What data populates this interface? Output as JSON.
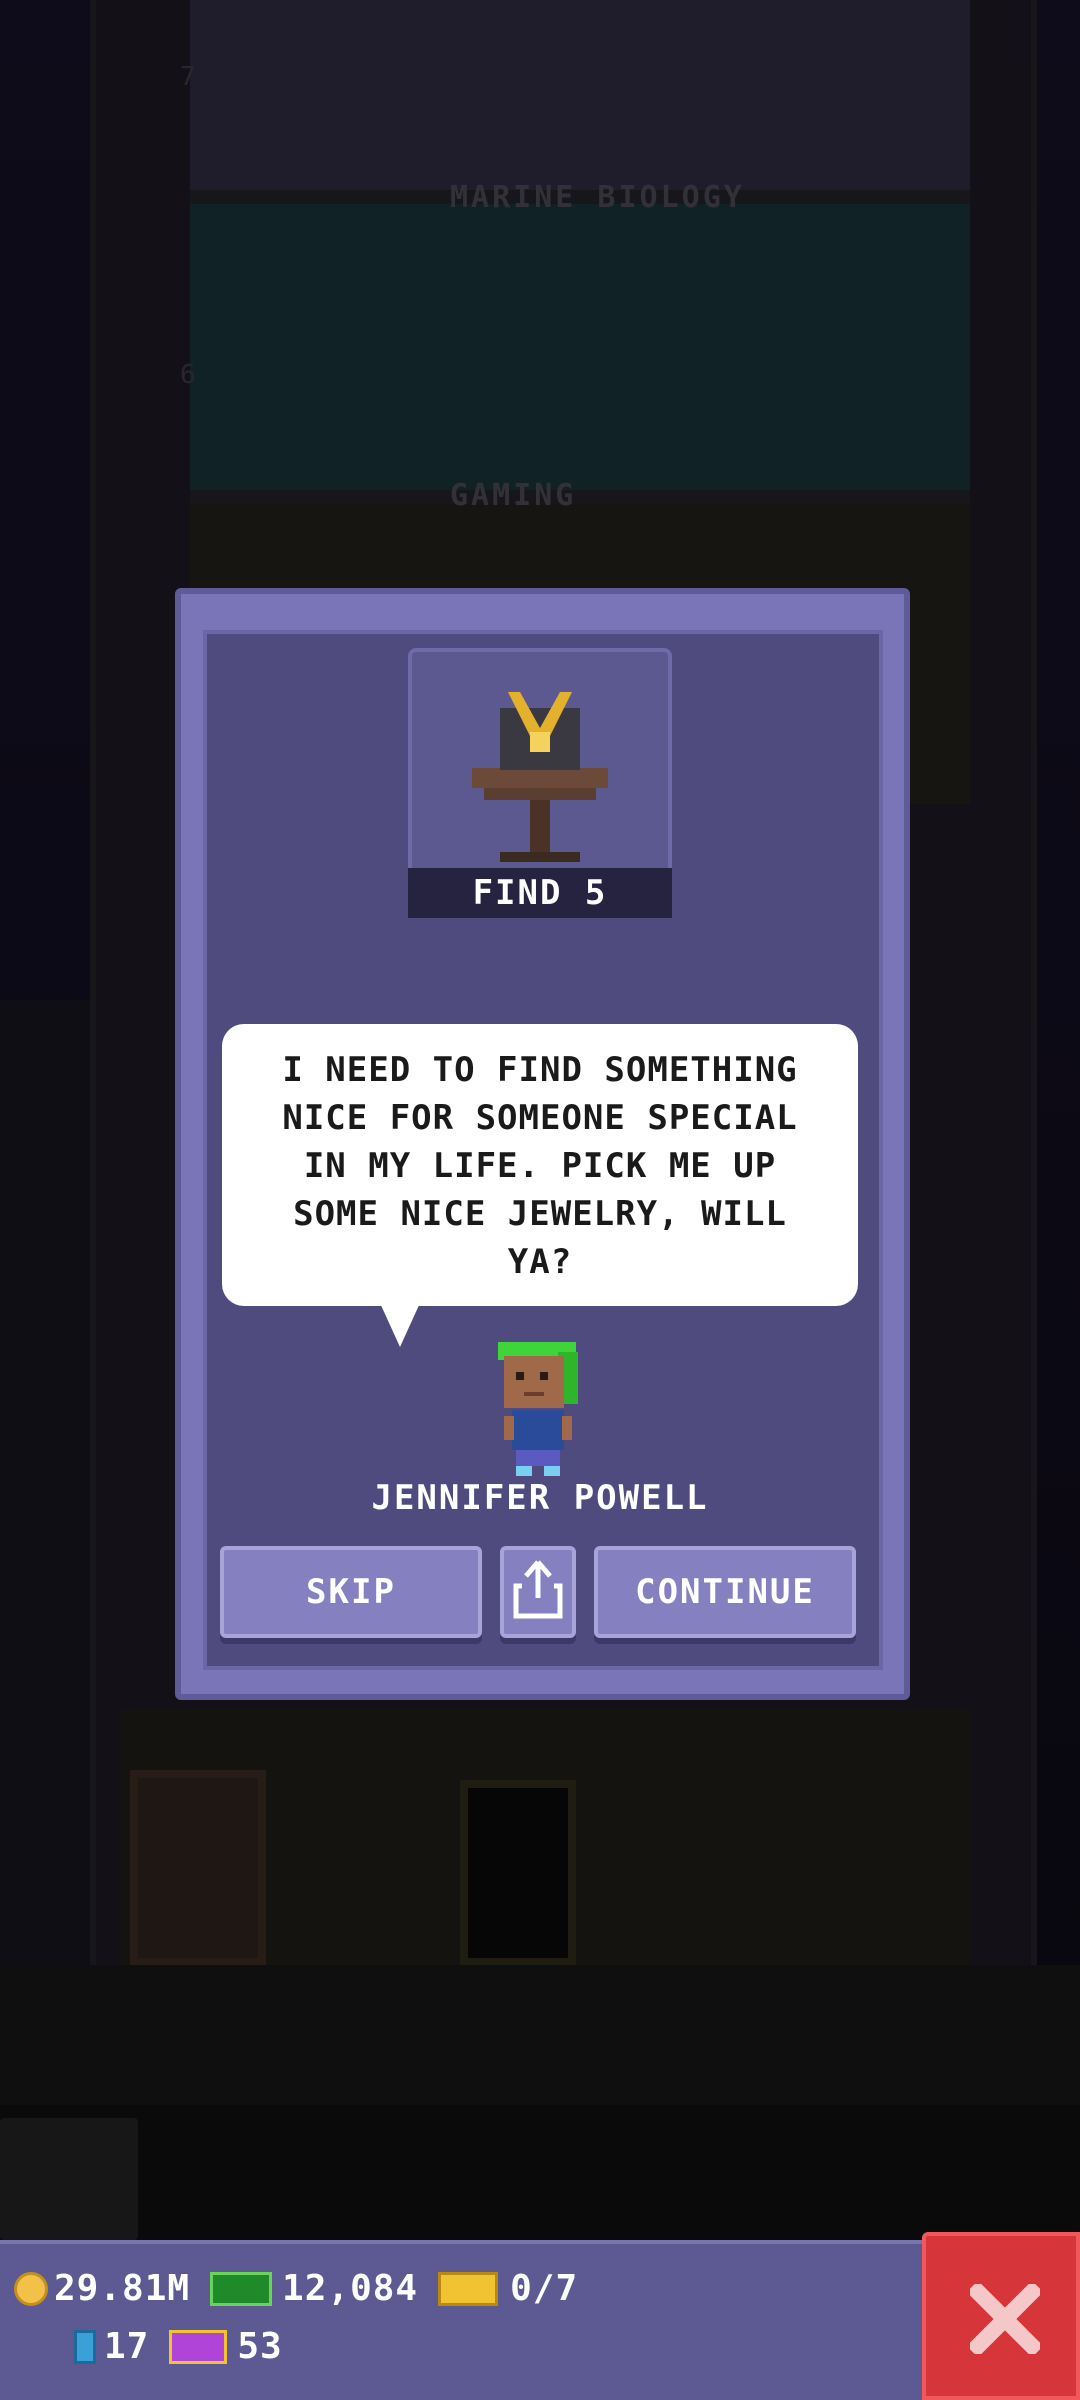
{
  "background": {
    "floor_labels": [
      "MARINE BIOLOGY",
      "GAMING"
    ],
    "floor_numbers": [
      "7",
      "6"
    ]
  },
  "dialog": {
    "mission": "FIND 5",
    "speech": "I NEED TO FIND SOMETHING NICE FOR SOMEONE SPECIAL IN MY LIFE. PICK ME UP SOME NICE JEWELRY, WILL YA?",
    "npc_name": "JENNIFER POWELL",
    "buttons": {
      "skip": "SKIP",
      "continue": "CONTINUE"
    }
  },
  "hud": {
    "coins": "29.81M",
    "bux": "12,084",
    "tickets": "0/7",
    "gems": "17",
    "vip": "53"
  },
  "colors": {
    "dialog_bg": "#4f4b7e",
    "button": "#8580c0",
    "close": "#d6353a",
    "hud": "#5d5992"
  },
  "icons": {
    "share": "share-icon",
    "close": "close-icon",
    "item": "jewelry-necklace-icon"
  }
}
